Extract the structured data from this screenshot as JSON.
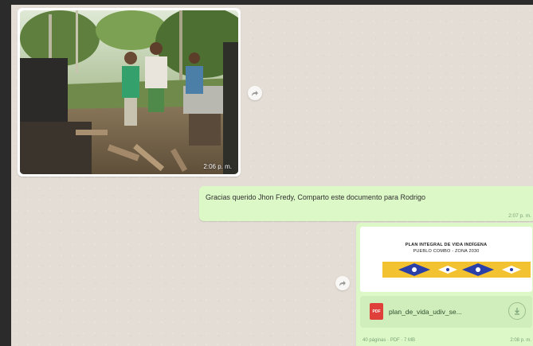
{
  "chat": {
    "photo_message": {
      "time": "2:06 p. m."
    },
    "text_message": {
      "text": "Gracias querido Jhon Fredy, Comparto este documento para Rodrigo",
      "time": "2:07 p. m."
    },
    "document_message": {
      "preview_title": "PLAN INTEGRAL DE VIDA INDÍGENA",
      "preview_subtitle": "PUEBLO COMBO - ZONA 2030",
      "file_name": "plan_de_vida_udiv_se...",
      "meta": "40 páginas · PDF · 7 MB",
      "time": "2:08 p. m."
    }
  },
  "colors": {
    "background": "#e3ddd5",
    "outgoing_bubble": "#dcf8c6",
    "pdf_icon": "#e0403a"
  },
  "icons": {
    "forward": "forward-icon",
    "download": "download-icon",
    "pdf": "pdf-file-icon"
  },
  "pdf_label": "PDF"
}
